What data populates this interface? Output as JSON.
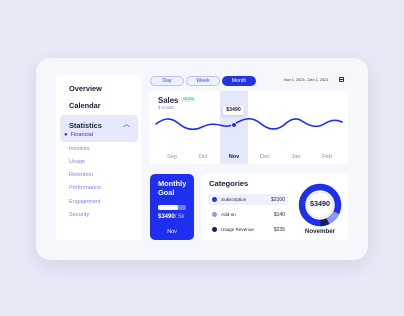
{
  "sidebar": {
    "items": [
      {
        "label": "Overview"
      },
      {
        "label": "Calendar"
      }
    ],
    "section": {
      "label": "Statistics",
      "active_sub": "Financial",
      "subs": [
        "Invoices",
        "Usage",
        "Retention",
        "Performance",
        "Engagement",
        "Security"
      ]
    }
  },
  "tabs": [
    {
      "label": "Day",
      "active": false
    },
    {
      "label": "Week",
      "active": false
    },
    {
      "label": "Month",
      "active": true
    }
  ],
  "date_range": "Nov 1, 2023 - Dec 1, 2023",
  "sales": {
    "title": "Sales",
    "badge": "+8.2%",
    "subtitle": "$ results",
    "tooltip": "$3490",
    "months": [
      "Sep",
      "Oct",
      "Nov",
      "Dec",
      "Jan",
      "Feb"
    ],
    "active_month": "Nov"
  },
  "goal": {
    "title": "Monthly Goal",
    "value": "$3490",
    "target": "/ 5k",
    "progress": 0.7,
    "month": "Nov"
  },
  "categories": {
    "title": "Categories",
    "items": [
      {
        "name": "Subscription",
        "amount": "$2100",
        "color": "#1e2ff0"
      },
      {
        "name": "Add-on",
        "amount": "$140",
        "color": "#8d98f5"
      },
      {
        "name": "Usage Revenue",
        "amount": "$235",
        "color": "#1a1f5e"
      }
    ],
    "total": "$3490",
    "period": "November"
  },
  "colors": {
    "accent": "#1e2ff0",
    "background": "#e6e9f6"
  }
}
